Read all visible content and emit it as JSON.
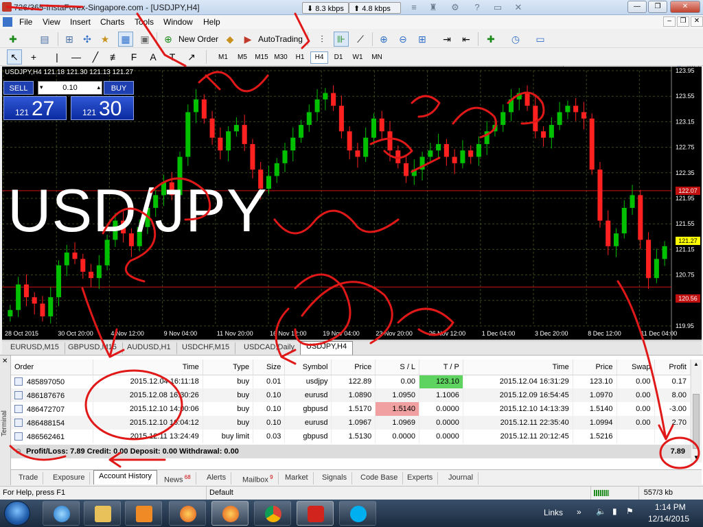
{
  "window": {
    "title_prefix": "726/365",
    "title": "-InstaForex-Singapore.com - [USDJPY,H4]",
    "net_down": "8.3 kbps",
    "net_up": "4.8 kbps"
  },
  "menu": [
    "File",
    "View",
    "Insert",
    "Charts",
    "Tools",
    "Window",
    "Help"
  ],
  "toolbar": {
    "new_order": "New Order",
    "autotrading": "AutoTrading"
  },
  "timeframes": [
    "M1",
    "M5",
    "M15",
    "M30",
    "H1",
    "H4",
    "D1",
    "W1",
    "MN"
  ],
  "selected_timeframe": "H4",
  "chart": {
    "header": "USDJPY,H4  121.18 121.30 121.13 121.27",
    "sell_label": "SELL",
    "buy_label": "BUY",
    "lot": "0.10",
    "sell_small": "121",
    "sell_big": "27",
    "buy_small": "121",
    "buy_big": "30",
    "pair_overlay": "USD/JPY",
    "price_labels": [
      "123.95",
      "123.55",
      "123.15",
      "122.75",
      "122.35",
      "121.95",
      "121.55",
      "121.15",
      "120.75",
      "120.35",
      "119.95"
    ],
    "ask_tag": "122.07",
    "bid_tag": "121.27",
    "low_tag": "120.56",
    "time_labels": [
      "28 Oct 2015",
      "30 Oct 20:00",
      "4 Nov 12:00",
      "9 Nov 04:00",
      "11 Nov 20:00",
      "16 Nov 12:00",
      "19 Nov 04:00",
      "23 Nov 20:00",
      "26 Nov 12:00",
      "1 Dec 04:00",
      "3 Dec 20:00",
      "8 Dec 12:00",
      "11 Dec 04:00"
    ]
  },
  "chart_data": {
    "type": "candlestick",
    "symbol": "USDJPY,H4",
    "open": 121.18,
    "high": 121.3,
    "low": 121.13,
    "close": 121.27,
    "ylim": [
      119.95,
      123.95
    ],
    "horizontal_lines": [
      122.07,
      120.56
    ],
    "x_ticks": [
      "28 Oct 2015",
      "30 Oct 20:00",
      "4 Nov 12:00",
      "9 Nov 04:00",
      "11 Nov 20:00",
      "16 Nov 12:00",
      "19 Nov 04:00",
      "23 Nov 20:00",
      "26 Nov 12:00",
      "1 Dec 04:00",
      "3 Dec 20:00",
      "8 Dec 12:00",
      "11 Dec 04:00"
    ],
    "y_ticks": [
      123.95,
      123.55,
      123.15,
      122.75,
      122.35,
      121.95,
      121.55,
      121.15,
      120.75,
      120.35,
      119.95
    ],
    "closes": [
      120.2,
      120.6,
      120.4,
      120.3,
      120.1,
      120.4,
      120.9,
      121.1,
      121.0,
      120.8,
      120.7,
      120.9,
      121.3,
      121.6,
      121.4,
      121.2,
      121.5,
      121.8,
      122.0,
      122.2,
      122.0,
      122.6,
      123.3,
      123.5,
      123.2,
      122.9,
      122.7,
      123.0,
      123.1,
      122.8,
      122.4,
      122.1,
      122.3,
      122.5,
      122.7,
      122.9,
      123.1,
      123.3,
      123.5,
      123.6,
      123.4,
      123.0,
      122.7,
      122.6,
      122.9,
      123.2,
      123.0,
      122.7,
      122.5,
      122.3,
      122.4,
      122.6,
      122.7,
      122.8,
      122.6,
      122.5,
      122.7,
      122.6,
      122.8,
      123.0,
      123.1,
      123.3,
      123.5,
      123.6,
      123.4,
      123.0,
      122.9,
      123.1,
      123.3,
      123.4,
      123.3,
      123.2,
      122.4,
      121.6,
      121.2,
      121.4,
      121.8,
      122.0,
      121.3,
      120.7,
      121.0,
      121.2
    ]
  },
  "chart_tabs": [
    "EURUSD,M15",
    "GBPUSD,M15",
    "AUDUSD,H1",
    "USDCHF,M15",
    "USDCAD,Daily",
    "USDJPY,H4"
  ],
  "selected_chart_tab": "USDJPY,H4",
  "history": {
    "columns": [
      "Order",
      "Time",
      "Type",
      "Size",
      "Symbol",
      "Price",
      "S / L",
      "T / P",
      "Time",
      "Price",
      "Swap",
      "Profit"
    ],
    "rows": [
      [
        "485897050",
        "2015.12.04 16:11:18",
        "buy",
        "0.01",
        "usdjpy",
        "122.89",
        "0.00",
        "123.10",
        "2015.12.04 16:31:29",
        "123.10",
        "0.00",
        "0.17"
      ],
      [
        "486187676",
        "2015.12.08 16:30:26",
        "buy",
        "0.10",
        "eurusd",
        "1.0890",
        "1.0950",
        "1.1006",
        "2015.12.09 16:54:45",
        "1.0970",
        "0.00",
        "8.00"
      ],
      [
        "486472707",
        "2015.12.10 14:00:06",
        "buy",
        "0.10",
        "gbpusd",
        "1.5170",
        "1.5140",
        "0.0000",
        "2015.12.10 14:13:39",
        "1.5140",
        "0.00",
        "-3.00"
      ],
      [
        "486488154",
        "2015.12.10 16:04:12",
        "buy",
        "0.10",
        "eurusd",
        "1.0967",
        "1.0969",
        "0.0000",
        "2015.12.11 22:35:40",
        "1.0994",
        "0.00",
        "2.70"
      ],
      [
        "486562461",
        "2015.12.11 13:24:49",
        "buy limit",
        "0.03",
        "gbpusd",
        "1.5130",
        "0.0000",
        "0.0000",
        "2015.12.11 20:12:45",
        "1.5216",
        "",
        ""
      ]
    ],
    "summary": "Profit/Loss: 7.89  Credit: 0.00  Deposit: 0.00  Withdrawal: 0.00",
    "total": "7.89"
  },
  "terminal": {
    "label": "Terminal",
    "tabs": [
      {
        "label": "Trade"
      },
      {
        "label": "Exposure"
      },
      {
        "label": "Account History"
      },
      {
        "label": "News",
        "badge": "68"
      },
      {
        "label": "Alerts"
      },
      {
        "label": "Mailbox",
        "badge": "9"
      },
      {
        "label": "Market"
      },
      {
        "label": "Signals"
      },
      {
        "label": "Code Base"
      },
      {
        "label": "Experts"
      },
      {
        "label": "Journal"
      }
    ],
    "selected_tab": "Account History"
  },
  "status": {
    "help": "For Help, press F1",
    "profile": "Default",
    "traffic": "557/3 kb"
  },
  "taskbar": {
    "links": "Links",
    "time": "1:14 PM",
    "date": "12/14/2015"
  },
  "colors": {
    "bull": "#00c000",
    "bear": "#ff2020",
    "annotation": "#e01818",
    "panel": "#1e3fb0"
  }
}
